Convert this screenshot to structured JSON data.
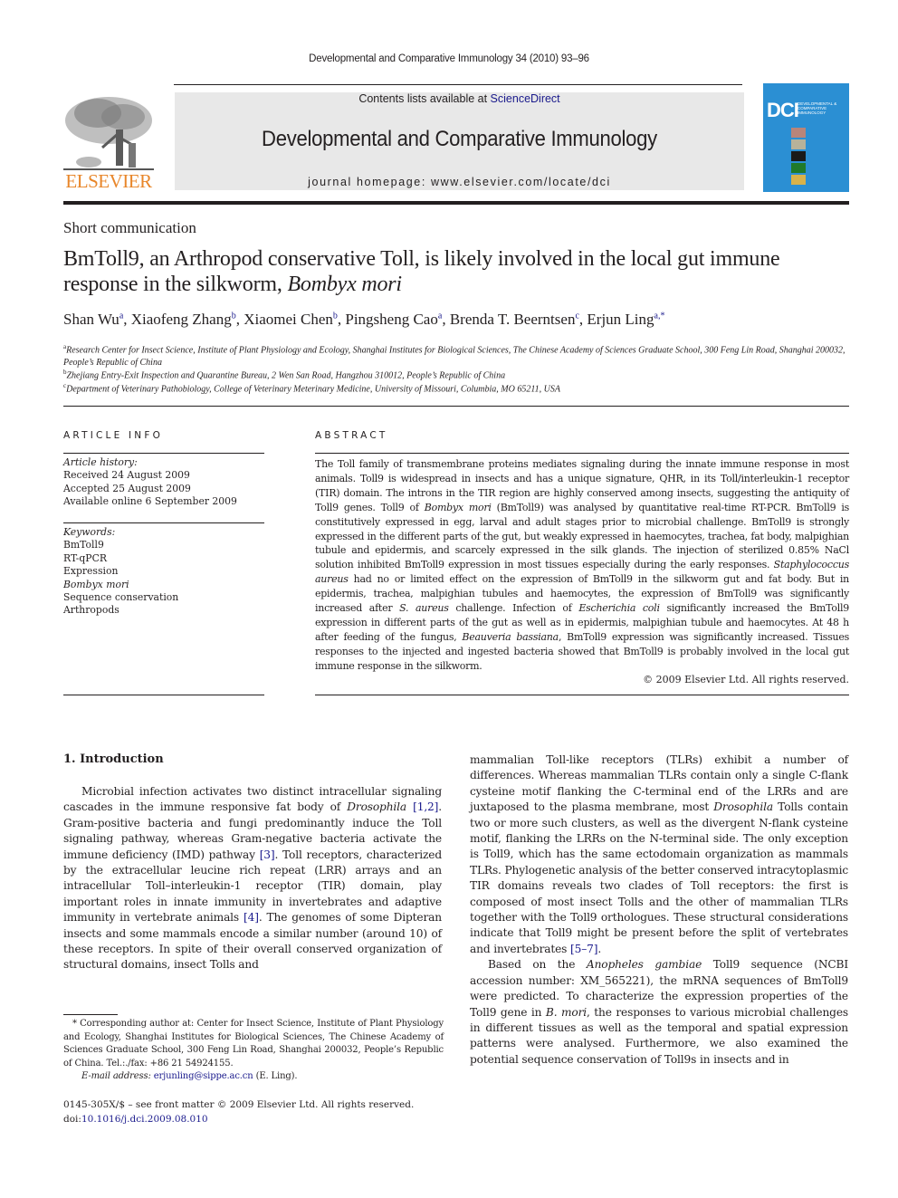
{
  "running_head": "Developmental and Comparative Immunology 34 (2010) 93–96",
  "banner": {
    "contents_prefix": "Contents lists available at ",
    "contents_link": "ScienceDirect",
    "journal_title": "Developmental and Comparative Immunology",
    "homepage_prefix": "journal homepage: ",
    "homepage_url": "www.elsevier.com/locate/dci"
  },
  "publisher_logo": {
    "icon": "elsevier-tree-icon",
    "wordmark": "ELSEVIER",
    "color": "#e8862a"
  },
  "journal_cover": {
    "acronym": "DCI",
    "subtitle": "DEVELOPMENTAL & COMPARATIVE IMMUNOLOGY",
    "color": "#2b8fd3"
  },
  "article": {
    "section_type": "Short communication",
    "title_main": "BmToll9, an Arthropod conservative Toll, is likely involved in the local gut immune response in the silkworm, ",
    "title_italic": "Bombyx mori",
    "authors": [
      {
        "name": "Shan Wu",
        "sup": "a"
      },
      {
        "name": "Xiaofeng Zhang",
        "sup": "b"
      },
      {
        "name": "Xiaomei Chen",
        "sup": "b"
      },
      {
        "name": "Pingsheng Cao",
        "sup": "a"
      },
      {
        "name": "Brenda T. Beerntsen",
        "sup": "c"
      },
      {
        "name": "Erjun Ling",
        "sup": "a,*"
      }
    ],
    "affiliations": [
      {
        "sup": "a",
        "text": "Research Center for Insect Science, Institute of Plant Physiology and Ecology, Shanghai Institutes for Biological Sciences, The Chinese Academy of Sciences Graduate School, 300 Feng Lin Road, Shanghai 200032, People’s Republic of China"
      },
      {
        "sup": "b",
        "text": "Zhejiang Entry-Exit Inspection and Quarantine Bureau, 2 Wen San Road, Hangzhou 310012, People’s Republic of China"
      },
      {
        "sup": "c",
        "text": "Department of Veterinary Pathobiology, College of Veterinary Meterinary Medicine, University of Missouri, Columbia, MO 65211, USA"
      }
    ]
  },
  "article_info": {
    "heading": "ARTICLE INFO",
    "history_label": "Article history:",
    "history": [
      "Received 24 August 2009",
      "Accepted 25 August 2009",
      "Available online 6 September 2009"
    ],
    "keywords_label": "Keywords:",
    "keywords": [
      "BmToll9",
      "RT-qPCR",
      "Expression",
      "Bombyx mori",
      "Sequence conservation",
      "Arthropods"
    ]
  },
  "abstract": {
    "heading": "ABSTRACT",
    "p1": "The Toll family of transmembrane proteins mediates signaling during the innate immune response in most animals. Toll9 is widespread in insects and has a unique signature, QHR, in its Toll/interleukin-1 receptor (TIR) domain. The introns in the TIR region are highly conserved among insects, suggesting the antiquity of Toll9 genes. Toll9 of ",
    "i1": "Bombyx mori",
    "p2": " (BmToll9) was analysed by quantitative real-time RT-PCR. BmToll9 is constitutively expressed in egg, larval and adult stages prior to microbial challenge. BmToll9 is strongly expressed in the different parts of the gut, but weakly expressed in haemocytes, trachea, fat body, malpighian tubule and epidermis, and scarcely expressed in the silk glands. The injection of sterilized 0.85% NaCl solution inhibited BmToll9 expression in most tissues especially during the early responses. ",
    "i2": "Staphylococcus aureus",
    "p3": " had no or limited effect on the expression of BmToll9 in the silkworm gut and fat body. But in epidermis, trachea, malpighian tubules and haemocytes, the expression of BmToll9 was significantly increased after ",
    "i3": "S. aureus",
    "p4": " challenge. Infection of ",
    "i4": "Escherichia coli",
    "p5": " significantly increased the BmToll9 expression in different parts of the gut as well as in epidermis, malpighian tubule and haemocytes. At 48 h after feeding of the fungus, ",
    "i5": "Beauveria bassiana",
    "p6": ", BmToll9 expression was significantly increased. Tissues responses to the injected and ingested bacteria showed that BmToll9 is probably involved in the local gut immune response in the silkworm.",
    "copyright": "© 2009 Elsevier Ltd. All rights reserved."
  },
  "introduction": {
    "heading": "1.  Introduction",
    "left": {
      "a": "Microbial infection activates two distinct intracellular signaling cascades in the immune responsive fat body of ",
      "a_i": "Drosophila",
      "ref1": "[1,2]",
      "b": ". Gram-positive bacteria and fungi predominantly induce the Toll signaling pathway, whereas Gram-negative bacteria activate the immune deficiency (IMD) pathway ",
      "ref2": "[3]",
      "c": ". Toll receptors, characterized by the extracellular leucine rich repeat (LRR) arrays and an intracellular Toll–interleukin-1 receptor (TIR) domain, play important roles in innate immunity in invertebrates and adaptive immunity in vertebrate animals ",
      "ref3": "[4]",
      "d": ". The genomes of some Dipteran insects and some mammals encode a similar number (around 10) of these receptors. In spite of their overall conserved organization of structural domains, insect Tolls and"
    },
    "right": {
      "a": "mammalian Toll-like receptors (TLRs) exhibit a number of differences. Whereas mammalian TLRs contain only a single C-flank cysteine motif flanking the C-terminal end of the LRRs and are juxtaposed to the plasma membrane, most ",
      "a_i": "Drosophila",
      "b": " Tolls contain two or more such clusters, as well as the divergent N-flank cysteine motif, flanking the LRRs on the N-terminal side. The only exception is Toll9, which has the same ectodomain organization as mammals TLRs. Phylogenetic analysis of the better conserved intracytoplasmic TIR domains reveals two clades of Toll receptors: the first is composed of most insect Tolls and the other of mammalian TLRs together with the Toll9 orthologues. These structural considerations indicate that Toll9 might be present before the split of vertebrates and invertebrates ",
      "ref": "[5–7]",
      "c": ".",
      "p2_a": "Based on the ",
      "p2_i1": "Anopheles gambiae",
      "p2_b": " Toll9 sequence (NCBI accession number: XM_565221), the mRNA sequences of BmToll9 were predicted. To characterize the expression properties of the Toll9 gene in ",
      "p2_i2": "B. mori",
      "p2_c": ", the responses to various microbial challenges in different tissues as well as the temporal and spatial expression patterns were analysed. Furthermore, we also examined the potential sequence conservation of Toll9s in insects and in"
    }
  },
  "footnote": {
    "star": "*",
    "text": " Corresponding author at: Center for Insect Science, Institute of Plant Physiology and Ecology, Shanghai Institutes for Biological Sciences, The Chinese Academy of Sciences Graduate School, 300 Feng Lin Road, Shanghai 200032, People’s Republic of China. Tel.:./fax: +86 21 54924155.",
    "email_label": "E-mail address: ",
    "email": "erjunling@sippe.ac.cn",
    "email_suffix": " (E. Ling)."
  },
  "bottom": {
    "issn": "0145-305X/$ – see front matter © 2009 Elsevier Ltd. All rights reserved.",
    "doi_label": "doi:",
    "doi": "10.1016/j.dci.2009.08.010"
  }
}
